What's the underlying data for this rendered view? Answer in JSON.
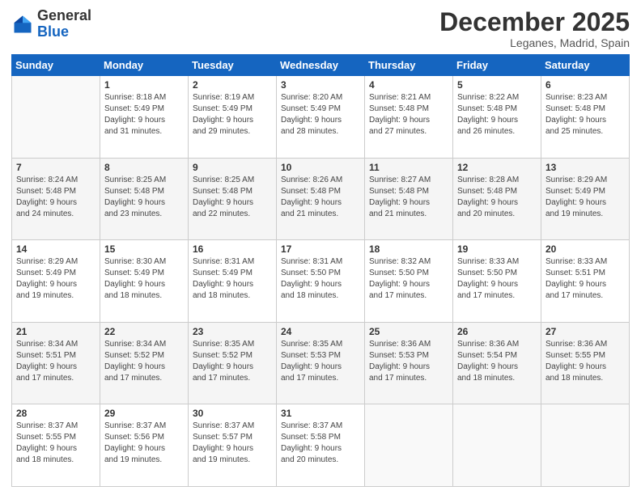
{
  "header": {
    "logo_general": "General",
    "logo_blue": "Blue",
    "month_title": "December 2025",
    "location": "Leganes, Madrid, Spain"
  },
  "days_of_week": [
    "Sunday",
    "Monday",
    "Tuesday",
    "Wednesday",
    "Thursday",
    "Friday",
    "Saturday"
  ],
  "weeks": [
    [
      {
        "day": "",
        "info": ""
      },
      {
        "day": "1",
        "info": "Sunrise: 8:18 AM\nSunset: 5:49 PM\nDaylight: 9 hours\nand 31 minutes."
      },
      {
        "day": "2",
        "info": "Sunrise: 8:19 AM\nSunset: 5:49 PM\nDaylight: 9 hours\nand 29 minutes."
      },
      {
        "day": "3",
        "info": "Sunrise: 8:20 AM\nSunset: 5:49 PM\nDaylight: 9 hours\nand 28 minutes."
      },
      {
        "day": "4",
        "info": "Sunrise: 8:21 AM\nSunset: 5:48 PM\nDaylight: 9 hours\nand 27 minutes."
      },
      {
        "day": "5",
        "info": "Sunrise: 8:22 AM\nSunset: 5:48 PM\nDaylight: 9 hours\nand 26 minutes."
      },
      {
        "day": "6",
        "info": "Sunrise: 8:23 AM\nSunset: 5:48 PM\nDaylight: 9 hours\nand 25 minutes."
      }
    ],
    [
      {
        "day": "7",
        "info": "Sunrise: 8:24 AM\nSunset: 5:48 PM\nDaylight: 9 hours\nand 24 minutes."
      },
      {
        "day": "8",
        "info": "Sunrise: 8:25 AM\nSunset: 5:48 PM\nDaylight: 9 hours\nand 23 minutes."
      },
      {
        "day": "9",
        "info": "Sunrise: 8:25 AM\nSunset: 5:48 PM\nDaylight: 9 hours\nand 22 minutes."
      },
      {
        "day": "10",
        "info": "Sunrise: 8:26 AM\nSunset: 5:48 PM\nDaylight: 9 hours\nand 21 minutes."
      },
      {
        "day": "11",
        "info": "Sunrise: 8:27 AM\nSunset: 5:48 PM\nDaylight: 9 hours\nand 21 minutes."
      },
      {
        "day": "12",
        "info": "Sunrise: 8:28 AM\nSunset: 5:48 PM\nDaylight: 9 hours\nand 20 minutes."
      },
      {
        "day": "13",
        "info": "Sunrise: 8:29 AM\nSunset: 5:49 PM\nDaylight: 9 hours\nand 19 minutes."
      }
    ],
    [
      {
        "day": "14",
        "info": "Sunrise: 8:29 AM\nSunset: 5:49 PM\nDaylight: 9 hours\nand 19 minutes."
      },
      {
        "day": "15",
        "info": "Sunrise: 8:30 AM\nSunset: 5:49 PM\nDaylight: 9 hours\nand 18 minutes."
      },
      {
        "day": "16",
        "info": "Sunrise: 8:31 AM\nSunset: 5:49 PM\nDaylight: 9 hours\nand 18 minutes."
      },
      {
        "day": "17",
        "info": "Sunrise: 8:31 AM\nSunset: 5:50 PM\nDaylight: 9 hours\nand 18 minutes."
      },
      {
        "day": "18",
        "info": "Sunrise: 8:32 AM\nSunset: 5:50 PM\nDaylight: 9 hours\nand 17 minutes."
      },
      {
        "day": "19",
        "info": "Sunrise: 8:33 AM\nSunset: 5:50 PM\nDaylight: 9 hours\nand 17 minutes."
      },
      {
        "day": "20",
        "info": "Sunrise: 8:33 AM\nSunset: 5:51 PM\nDaylight: 9 hours\nand 17 minutes."
      }
    ],
    [
      {
        "day": "21",
        "info": "Sunrise: 8:34 AM\nSunset: 5:51 PM\nDaylight: 9 hours\nand 17 minutes."
      },
      {
        "day": "22",
        "info": "Sunrise: 8:34 AM\nSunset: 5:52 PM\nDaylight: 9 hours\nand 17 minutes."
      },
      {
        "day": "23",
        "info": "Sunrise: 8:35 AM\nSunset: 5:52 PM\nDaylight: 9 hours\nand 17 minutes."
      },
      {
        "day": "24",
        "info": "Sunrise: 8:35 AM\nSunset: 5:53 PM\nDaylight: 9 hours\nand 17 minutes."
      },
      {
        "day": "25",
        "info": "Sunrise: 8:36 AM\nSunset: 5:53 PM\nDaylight: 9 hours\nand 17 minutes."
      },
      {
        "day": "26",
        "info": "Sunrise: 8:36 AM\nSunset: 5:54 PM\nDaylight: 9 hours\nand 18 minutes."
      },
      {
        "day": "27",
        "info": "Sunrise: 8:36 AM\nSunset: 5:55 PM\nDaylight: 9 hours\nand 18 minutes."
      }
    ],
    [
      {
        "day": "28",
        "info": "Sunrise: 8:37 AM\nSunset: 5:55 PM\nDaylight: 9 hours\nand 18 minutes."
      },
      {
        "day": "29",
        "info": "Sunrise: 8:37 AM\nSunset: 5:56 PM\nDaylight: 9 hours\nand 19 minutes."
      },
      {
        "day": "30",
        "info": "Sunrise: 8:37 AM\nSunset: 5:57 PM\nDaylight: 9 hours\nand 19 minutes."
      },
      {
        "day": "31",
        "info": "Sunrise: 8:37 AM\nSunset: 5:58 PM\nDaylight: 9 hours\nand 20 minutes."
      },
      {
        "day": "",
        "info": ""
      },
      {
        "day": "",
        "info": ""
      },
      {
        "day": "",
        "info": ""
      }
    ]
  ]
}
